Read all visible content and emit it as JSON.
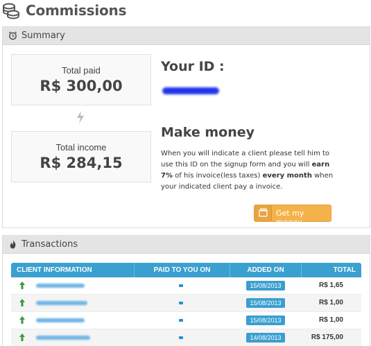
{
  "page": {
    "title": "Commissions",
    "icon": "coins-icon"
  },
  "summary": {
    "title": "Summary",
    "icon": "alarm-clock-icon",
    "total_paid_label": "Total paid",
    "total_paid_value": "R$ 300,00",
    "total_income_label": "Total income",
    "total_income_value": "R$ 284,15",
    "id_title": "Your ID :",
    "make_money_title": "Make money",
    "make_money_text": {
      "p1": "When you will indicate a client please tell him to use this ID on the signup form and you will ",
      "b1": "earn 7%",
      "p2": " of his invoice(less taxes) ",
      "b2": "every month",
      "p3": " when your indicated client pay a invoice."
    },
    "button_label": "Get my money",
    "accent_color": "#f5b24a"
  },
  "transactions": {
    "title": "Transactions",
    "icon": "fire-icon",
    "columns": [
      "CLIENT INFORMATION",
      "PAID TO YOU ON",
      "ADDED ON",
      "TOTAL"
    ],
    "rows": [
      {
        "paid_on": "-",
        "added_on": "15/08/2013",
        "total": "R$ 1,65"
      },
      {
        "paid_on": "-",
        "added_on": "15/08/2013",
        "total": "R$ 1,00"
      },
      {
        "paid_on": "-",
        "added_on": "15/08/2013",
        "total": "R$ 1,00"
      },
      {
        "paid_on": "-",
        "added_on": "14/08/2013",
        "total": "R$ 175,00"
      }
    ],
    "header_color": "#3aa0cf"
  }
}
